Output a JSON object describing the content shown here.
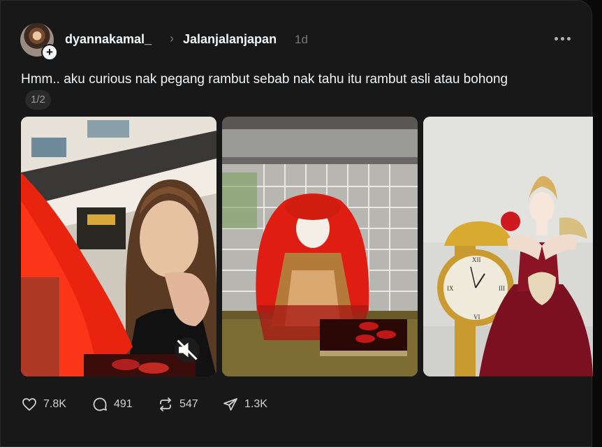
{
  "post": {
    "username": "dyannakamal_",
    "chevron": "›",
    "topic": "Jalanjalanjapan",
    "time": "1d",
    "text": "Hmm.. aku curious nak pegang rambut sebab nak tahu itu rambut asli atau bohong",
    "page_indicator": "1/2"
  },
  "media": [
    {
      "alt_icon": "muted-video-icon"
    },
    {},
    {}
  ],
  "actions": {
    "likes": "7.8K",
    "comments": "491",
    "reposts": "547",
    "shares": "1.3K"
  },
  "colors": {
    "background": "#0a0a0a",
    "card": "#181818",
    "text": "#f3f5f7",
    "muted": "#777777"
  }
}
